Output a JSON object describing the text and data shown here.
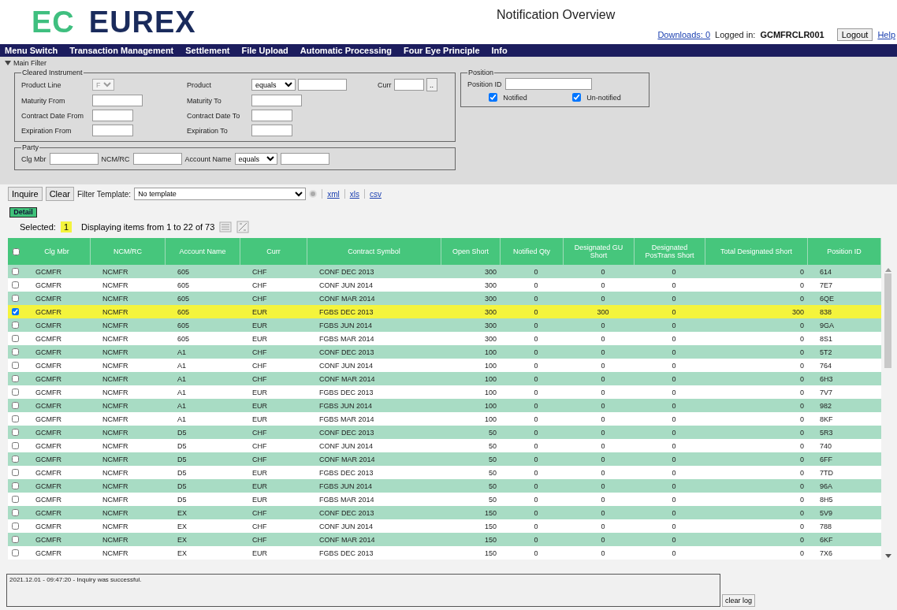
{
  "header": {
    "logo_mark": "EC",
    "logo_text": "EUREX",
    "title": "Notification Overview",
    "downloads": "Downloads: 0",
    "logged_in_label": "Logged in:",
    "user": "GCMFRCLR001",
    "logout": "Logout",
    "help": "Help"
  },
  "menu": [
    "Menu Switch",
    "Transaction Management",
    "Settlement",
    "File Upload",
    "Automatic Processing",
    "Four Eye Principle",
    "Info"
  ],
  "main_filter": {
    "label": "Main Filter",
    "expanded": true,
    "cleared_instrument": {
      "legend": "Cleared Instrument",
      "product_line_label": "Product Line",
      "product_line_value": "F",
      "product_label": "Product",
      "product_op": "equals",
      "curr_label": "Curr",
      "lookup": "..",
      "maturity_from": "Maturity From",
      "maturity_to": "Maturity To",
      "contract_date_from": "Contract Date From",
      "contract_date_to": "Contract Date To",
      "expiration_from": "Expiration From",
      "expiration_to": "Expiration To"
    },
    "party": {
      "legend": "Party",
      "clg_mbr": "Clg Mbr",
      "ncm_rc": "NCM/RC",
      "account_name": "Account Name",
      "account_op": "equals"
    },
    "position": {
      "legend": "Position",
      "position_id": "Position ID",
      "checks": [
        {
          "label": "Notified",
          "checked": true
        },
        {
          "label": "Un-notified",
          "checked": true
        }
      ]
    }
  },
  "toolbar": {
    "inquire": "Inquire",
    "clear": "Clear",
    "template_label": "Filter Template:",
    "template_value": "No template",
    "links": [
      "xml",
      "xls",
      "csv"
    ]
  },
  "detail_button": "Detail",
  "selection": {
    "label": "Selected:",
    "count": "1",
    "info": "Displaying items from 1 to 22 of 73"
  },
  "table": {
    "select_all_checked": false,
    "columns": [
      "Clg Mbr",
      "NCM/RC",
      "Account Name",
      "Curr",
      "Contract Symbol",
      "Open Short",
      "Notified Qty",
      "Designated GU Short",
      "Designated PosTrans Short",
      "Total Designated Short",
      "Position ID"
    ],
    "rows": [
      {
        "selected": false,
        "cells": [
          "GCMFR",
          "NCMFR",
          "605",
          "CHF",
          "CONF DEC 2013",
          "300",
          "0",
          "0",
          "0",
          "0",
          "614"
        ]
      },
      {
        "selected": false,
        "cells": [
          "GCMFR",
          "NCMFR",
          "605",
          "CHF",
          "CONF JUN 2014",
          "300",
          "0",
          "0",
          "0",
          "0",
          "7E7"
        ]
      },
      {
        "selected": false,
        "cells": [
          "GCMFR",
          "NCMFR",
          "605",
          "CHF",
          "CONF MAR 2014",
          "300",
          "0",
          "0",
          "0",
          "0",
          "6QE"
        ]
      },
      {
        "selected": true,
        "cells": [
          "GCMFR",
          "NCMFR",
          "605",
          "EUR",
          "FGBS DEC 2013",
          "300",
          "0",
          "300",
          "0",
          "300",
          "838"
        ]
      },
      {
        "selected": false,
        "cells": [
          "GCMFR",
          "NCMFR",
          "605",
          "EUR",
          "FGBS JUN 2014",
          "300",
          "0",
          "0",
          "0",
          "0",
          "9GA"
        ]
      },
      {
        "selected": false,
        "cells": [
          "GCMFR",
          "NCMFR",
          "605",
          "EUR",
          "FGBS MAR 2014",
          "300",
          "0",
          "0",
          "0",
          "0",
          "8S1"
        ]
      },
      {
        "selected": false,
        "cells": [
          "GCMFR",
          "NCMFR",
          "A1",
          "CHF",
          "CONF DEC 2013",
          "100",
          "0",
          "0",
          "0",
          "0",
          "5T2"
        ]
      },
      {
        "selected": false,
        "cells": [
          "GCMFR",
          "NCMFR",
          "A1",
          "CHF",
          "CONF JUN 2014",
          "100",
          "0",
          "0",
          "0",
          "0",
          "764"
        ]
      },
      {
        "selected": false,
        "cells": [
          "GCMFR",
          "NCMFR",
          "A1",
          "CHF",
          "CONF MAR 2014",
          "100",
          "0",
          "0",
          "0",
          "0",
          "6H3"
        ]
      },
      {
        "selected": false,
        "cells": [
          "GCMFR",
          "NCMFR",
          "A1",
          "EUR",
          "FGBS DEC 2013",
          "100",
          "0",
          "0",
          "0",
          "0",
          "7V7"
        ]
      },
      {
        "selected": false,
        "cells": [
          "GCMFR",
          "NCMFR",
          "A1",
          "EUR",
          "FGBS JUN 2014",
          "100",
          "0",
          "0",
          "0",
          "0",
          "982"
        ]
      },
      {
        "selected": false,
        "cells": [
          "GCMFR",
          "NCMFR",
          "A1",
          "EUR",
          "FGBS MAR 2014",
          "100",
          "0",
          "0",
          "0",
          "0",
          "8KF"
        ]
      },
      {
        "selected": false,
        "cells": [
          "GCMFR",
          "NCMFR",
          "D5",
          "CHF",
          "CONF DEC 2013",
          "50",
          "0",
          "0",
          "0",
          "0",
          "5R3"
        ]
      },
      {
        "selected": false,
        "cells": [
          "GCMFR",
          "NCMFR",
          "D5",
          "CHF",
          "CONF JUN 2014",
          "50",
          "0",
          "0",
          "0",
          "0",
          "740"
        ]
      },
      {
        "selected": false,
        "cells": [
          "GCMFR",
          "NCMFR",
          "D5",
          "CHF",
          "CONF MAR 2014",
          "50",
          "0",
          "0",
          "0",
          "0",
          "6FF"
        ]
      },
      {
        "selected": false,
        "cells": [
          "GCMFR",
          "NCMFR",
          "D5",
          "EUR",
          "FGBS DEC 2013",
          "50",
          "0",
          "0",
          "0",
          "0",
          "7TD"
        ]
      },
      {
        "selected": false,
        "cells": [
          "GCMFR",
          "NCMFR",
          "D5",
          "EUR",
          "FGBS JUN 2014",
          "50",
          "0",
          "0",
          "0",
          "0",
          "96A"
        ]
      },
      {
        "selected": false,
        "cells": [
          "GCMFR",
          "NCMFR",
          "D5",
          "EUR",
          "FGBS MAR 2014",
          "50",
          "0",
          "0",
          "0",
          "0",
          "8H5"
        ]
      },
      {
        "selected": false,
        "cells": [
          "GCMFR",
          "NCMFR",
          "EX",
          "CHF",
          "CONF DEC 2013",
          "150",
          "0",
          "0",
          "0",
          "0",
          "5V9"
        ]
      },
      {
        "selected": false,
        "cells": [
          "GCMFR",
          "NCMFR",
          "EX",
          "CHF",
          "CONF JUN 2014",
          "150",
          "0",
          "0",
          "0",
          "0",
          "788"
        ]
      },
      {
        "selected": false,
        "cells": [
          "GCMFR",
          "NCMFR",
          "EX",
          "CHF",
          "CONF MAR 2014",
          "150",
          "0",
          "0",
          "0",
          "0",
          "6KF"
        ]
      },
      {
        "selected": false,
        "cells": [
          "GCMFR",
          "NCMFR",
          "EX",
          "EUR",
          "FGBS DEC 2013",
          "150",
          "0",
          "0",
          "0",
          "0",
          "7X6"
        ]
      }
    ]
  },
  "log": {
    "text": "2021.12.01 - 09:47:20 - Inquiry was successful.",
    "clear": "clear log"
  }
}
